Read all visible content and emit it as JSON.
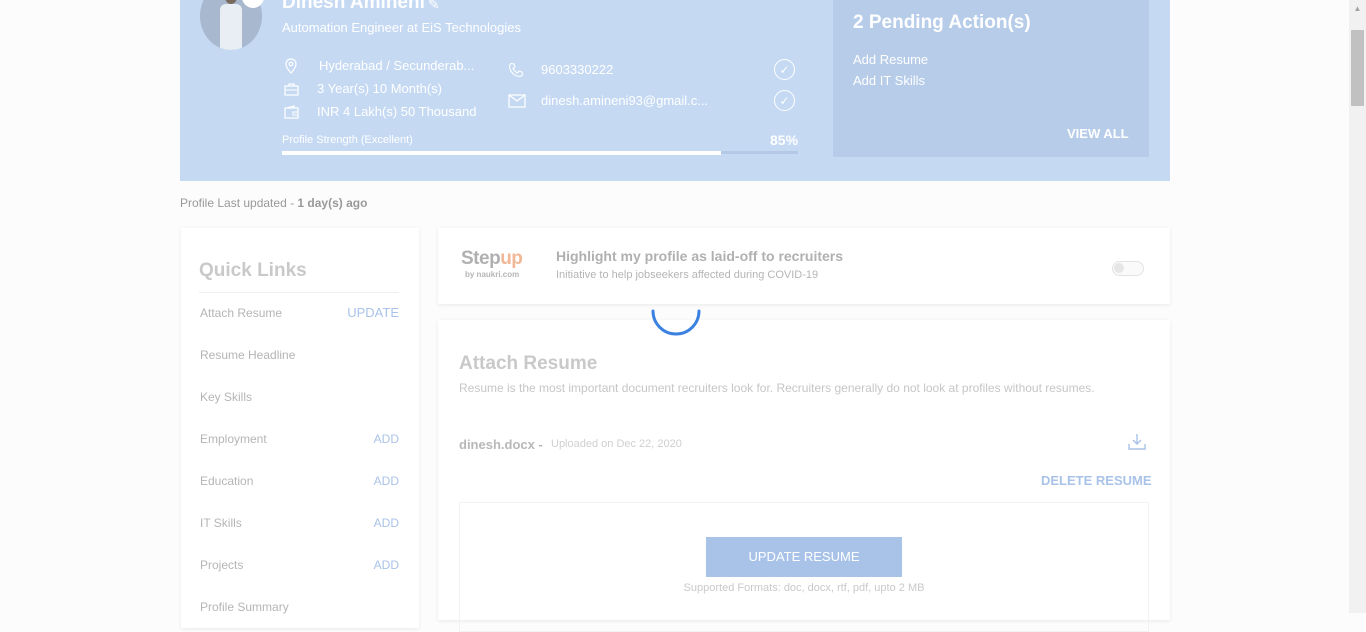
{
  "profile": {
    "name": "Dinesh Amineni",
    "designation": "Automation Engineer at EiS Technologies",
    "location": "Hyderabad / Secunderab...",
    "experience": "3 Year(s) 10 Month(s)",
    "salary": "INR 4 Lakh(s) 50 Thousand",
    "phone": "9603330222",
    "email": "dinesh.amineni93@gmail.c...",
    "strength_label": "Profile Strength (Excellent)",
    "strength_pct": "85%",
    "strength_value": 0.85
  },
  "pending": {
    "title": "2 Pending Action(s)",
    "items": [
      "Add Resume",
      "Add IT Skills"
    ],
    "view_all": "VIEW ALL"
  },
  "last_updated": {
    "prefix": "Profile Last updated - ",
    "value": "1 day(s) ago"
  },
  "quick_links": {
    "title": "Quick Links",
    "items": [
      {
        "label": "Attach Resume",
        "action": "UPDATE"
      },
      {
        "label": "Resume Headline",
        "action": ""
      },
      {
        "label": "Key Skills",
        "action": ""
      },
      {
        "label": "Employment",
        "action": "ADD"
      },
      {
        "label": "Education",
        "action": "ADD"
      },
      {
        "label": "IT Skills",
        "action": "ADD"
      },
      {
        "label": "Projects",
        "action": "ADD"
      },
      {
        "label": "Profile Summary",
        "action": ""
      }
    ]
  },
  "stepup": {
    "logo_main": "Step",
    "logo_accent": "up",
    "logo_sub": "by naukri.com",
    "title": "Highlight my profile as laid-off to recruiters",
    "subtitle": "Initiative to help jobseekers affected during COVID-19",
    "toggle_on": false
  },
  "attach_resume": {
    "title": "Attach Resume",
    "description": "Resume is the most important document recruiters look for. Recruiters generally do not look at profiles without resumes.",
    "file_name": "dinesh.docx -",
    "file_date": "Uploaded on Dec 22, 2020",
    "delete_label": "DELETE RESUME",
    "update_label": "UPDATE RESUME",
    "formats": "Supported Formats: doc, docx, rtf, pdf, upto 2 MB"
  },
  "colors": {
    "header_bg": "#c5d9f3",
    "pending_bg": "#b6cce9",
    "accent": "#a9c3e8",
    "spinner": "#3b82e0"
  }
}
